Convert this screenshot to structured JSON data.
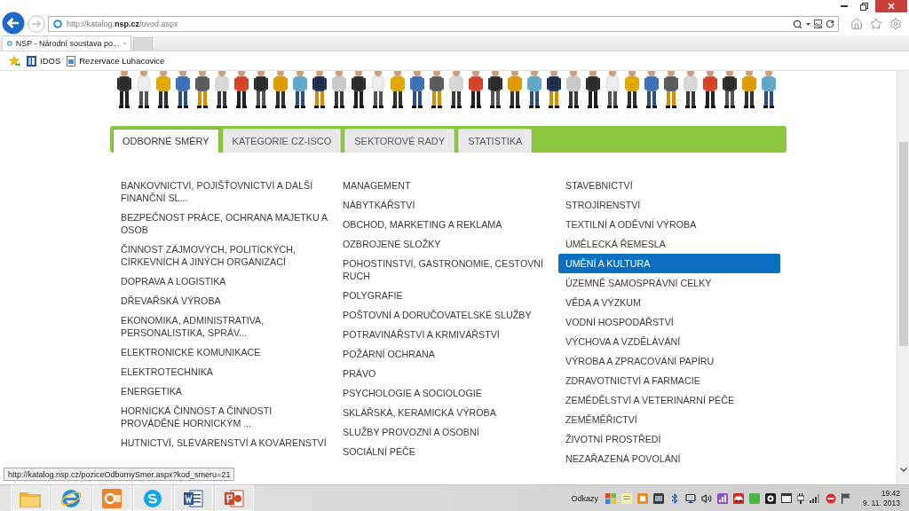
{
  "browser": {
    "address": {
      "url": "http://katalog.**nsp.cz**/uvod.aspx"
    },
    "tabs": [
      {
        "title": "NSP - Národní soustava po...",
        "selected": true
      }
    ],
    "favorites": [
      {
        "kind": "app",
        "label": "IDOS"
      },
      {
        "kind": "webpage",
        "label": "Rezervace Luhacovice"
      }
    ]
  },
  "page": {
    "tabs": [
      {
        "label": "ODBORNÉ SMĚRY",
        "selected": true
      },
      {
        "label": "KATEGORIE CZ-ISCO",
        "selected": false
      },
      {
        "label": "SEKTOROVÉ RADY",
        "selected": false
      },
      {
        "label": "STATISTIKA",
        "selected": false
      }
    ],
    "columns": [
      {
        "items": [
          {
            "label": "BANKOVNICTVÍ, POJIŠŤOVNICTVÍ A DALŠÍ FINANČNÍ SL...",
            "selected": false
          },
          {
            "label": "BEZPEČNOST PRÁCE, OCHRANA MAJETKU A OSOB",
            "selected": false
          },
          {
            "label": "ČINNOST ZÁJMOVÝCH, POLITICKÝCH, CÍRKEVNÍCH A JINÝCH ORGANIZACÍ",
            "selected": false
          },
          {
            "label": "DOPRAVA A LOGISTIKA",
            "selected": false
          },
          {
            "label": "DŘEVAŘSKÁ VÝROBA",
            "selected": false
          },
          {
            "label": "EKONOMIKA, ADMINISTRATIVA, PERSONALISTIKA, SPRÁV...",
            "selected": false
          },
          {
            "label": "ELEKTRONICKÉ KOMUNIKACE",
            "selected": false
          },
          {
            "label": "ELEKTROTECHNIKA",
            "selected": false
          },
          {
            "label": "ENERGETIKA",
            "selected": false
          },
          {
            "label": "HORNICKÁ ČINNOST A ČINNOSTI PROVÁDĚNÉ HORNICKÝM ...",
            "selected": false
          },
          {
            "label": "HUTNICTVÍ, SLÉVÁRENSTVÍ A KOVÁRENSTVÍ",
            "selected": false
          }
        ]
      },
      {
        "items": [
          {
            "label": "MANAGEMENT",
            "selected": false
          },
          {
            "label": "NÁBYTKÁŘSTVÍ",
            "selected": false
          },
          {
            "label": "OBCHOD, MARKETING A REKLAMA",
            "selected": false
          },
          {
            "label": "OZBROJENÉ SLOŽKY",
            "selected": false
          },
          {
            "label": "POHOSTINSTVÍ, GASTRONOMIE, CESTOVNÍ RUCH",
            "selected": false
          },
          {
            "label": "POLYGRAFIE",
            "selected": false
          },
          {
            "label": "POŠTOVNÍ A DORUČOVATELSKÉ SLUŽBY",
            "selected": false
          },
          {
            "label": "POTRAVINÁŘSTVÍ A KRMIVÁŘSTVÍ",
            "selected": false
          },
          {
            "label": "POŽÁRNÍ OCHRANA",
            "selected": false
          },
          {
            "label": "PRÁVO",
            "selected": false
          },
          {
            "label": "PSYCHOLOGIE A SOCIOLOGIE",
            "selected": false
          },
          {
            "label": "SKLÁŘSKÁ, KERAMICKÁ VÝROBA",
            "selected": false
          },
          {
            "label": "SLUŽBY PROVOZNÍ A OSOBNÍ",
            "selected": false
          },
          {
            "label": "SOCIÁLNÍ PÉČE",
            "selected": false
          }
        ]
      },
      {
        "items": [
          {
            "label": "STAVEBNICTVÍ",
            "selected": false
          },
          {
            "label": "STROJÍRENSTVÍ",
            "selected": false
          },
          {
            "label": "TEXTILNÍ A ODĚVNÍ VÝROBA",
            "selected": false
          },
          {
            "label": "UMĚLECKÁ ŘEMESLA",
            "selected": false
          },
          {
            "label": "UMĚNÍ A KULTURA",
            "selected": true
          },
          {
            "label": "ÚZEMNĚ SAMOSPRÁVNÍ CELKY",
            "selected": false
          },
          {
            "label": "VĚDA A VÝZKUM",
            "selected": false
          },
          {
            "label": "VODNÍ HOSPODÁŘSTVÍ",
            "selected": false
          },
          {
            "label": "VÝCHOVA A VZDĚLÁVÁNÍ",
            "selected": false
          },
          {
            "label": "VÝROBA A ZPRACOVÁNÍ PAPÍRU",
            "selected": false
          },
          {
            "label": "ZDRAVOTNICTVÍ A FARMACIE",
            "selected": false
          },
          {
            "label": "ZEMĚDĚLSTVÍ A VETERINÁRNÍ PÉČE",
            "selected": false
          },
          {
            "label": "ZEMĚMĚŘICTVÍ",
            "selected": false
          },
          {
            "label": "ŽIVOTNÍ PROSTŘEDÍ",
            "selected": false
          },
          {
            "label": "NEZAŘAZENÁ POVOLÁNÍ",
            "selected": false
          }
        ]
      }
    ]
  },
  "status_tooltip": {
    "text": "http://katalog.nsp.cz/poziceOdbornySmer.aspx?kod_smeru=21"
  },
  "taskbar": {
    "toolbar_label": "Odkazy",
    "clock": {
      "time": "19:42",
      "date": "9. 11. 2013"
    }
  }
}
